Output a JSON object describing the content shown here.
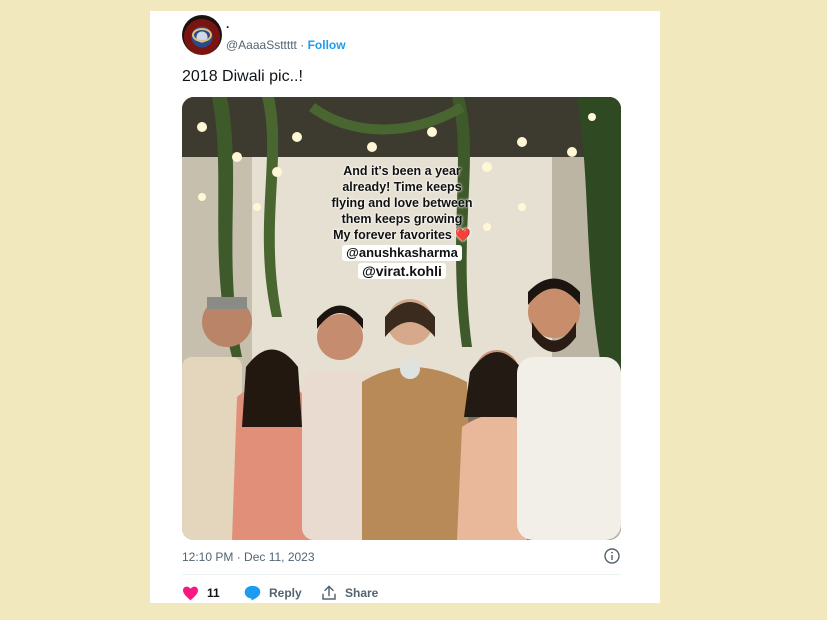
{
  "tweet": {
    "display_name": ".",
    "handle": "@AaaaSsttttt",
    "separator": "·",
    "follow_label": "Follow",
    "text": "2018 Diwali pic..!",
    "timestamp": "12:10 PM · Dec 11, 2023"
  },
  "media": {
    "overlay_lines": [
      "And it's been a year",
      "already! Time keeps",
      "flying and love between",
      "them keeps growing",
      "My forever favorites"
    ],
    "heart_emoji": "❤️",
    "tag_1": "@anushkasharma",
    "tag_2": "@virat.kohli"
  },
  "actions": {
    "like_count": "11",
    "reply_label": "Reply",
    "share_label": "Share"
  },
  "colors": {
    "page_background": "#f2e8bd",
    "accent": "#1d9bf0",
    "heart": "#f91880",
    "secondary_text": "#536471"
  },
  "icons": [
    "avatar",
    "info-icon",
    "heart-icon",
    "reply-bubble-icon",
    "share-icon"
  ]
}
